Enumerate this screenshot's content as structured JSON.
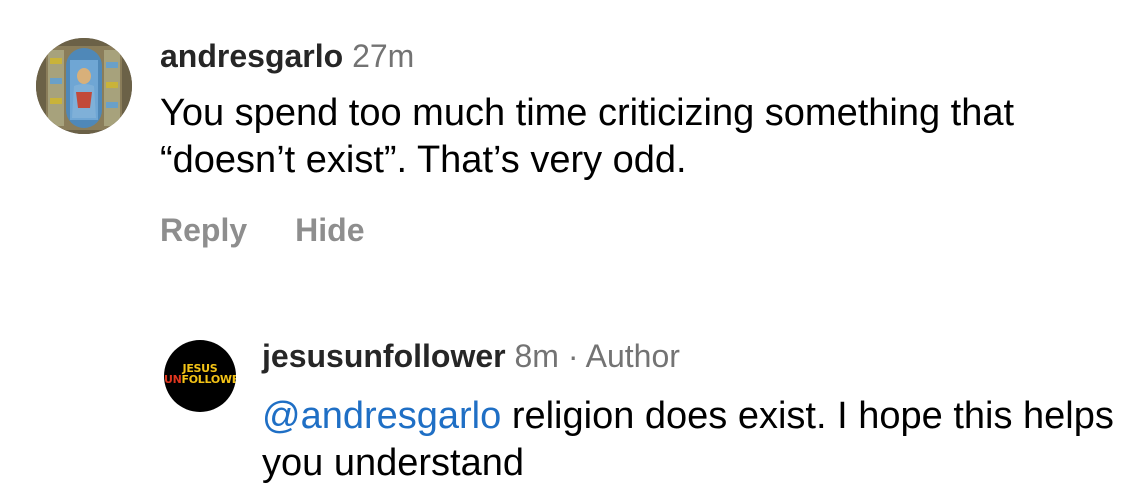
{
  "comments": [
    {
      "username": "andresgarlo",
      "time": "27m",
      "text": "You spend too much time criticizing something that “doesn’t exist”. That’s very odd.",
      "actions": {
        "reply": "Reply",
        "hide": "Hide"
      }
    }
  ],
  "reply": {
    "username": "jesusunfollower",
    "time": "8m",
    "separator": "·",
    "badge": "Author",
    "mention": "@andresgarlo",
    "text": " religion does exist. I hope this helps you understand",
    "avatar_logo": {
      "line1": "JESUS",
      "line2_prefix": "UN",
      "line2_suffix": "FOLLOWER"
    }
  },
  "colors": {
    "username": "#262626",
    "meta": "#737373",
    "action": "#8e8e8e",
    "mention": "#1f6fc5",
    "logo_yellow": "#f3c316",
    "logo_red": "#e0361f"
  }
}
